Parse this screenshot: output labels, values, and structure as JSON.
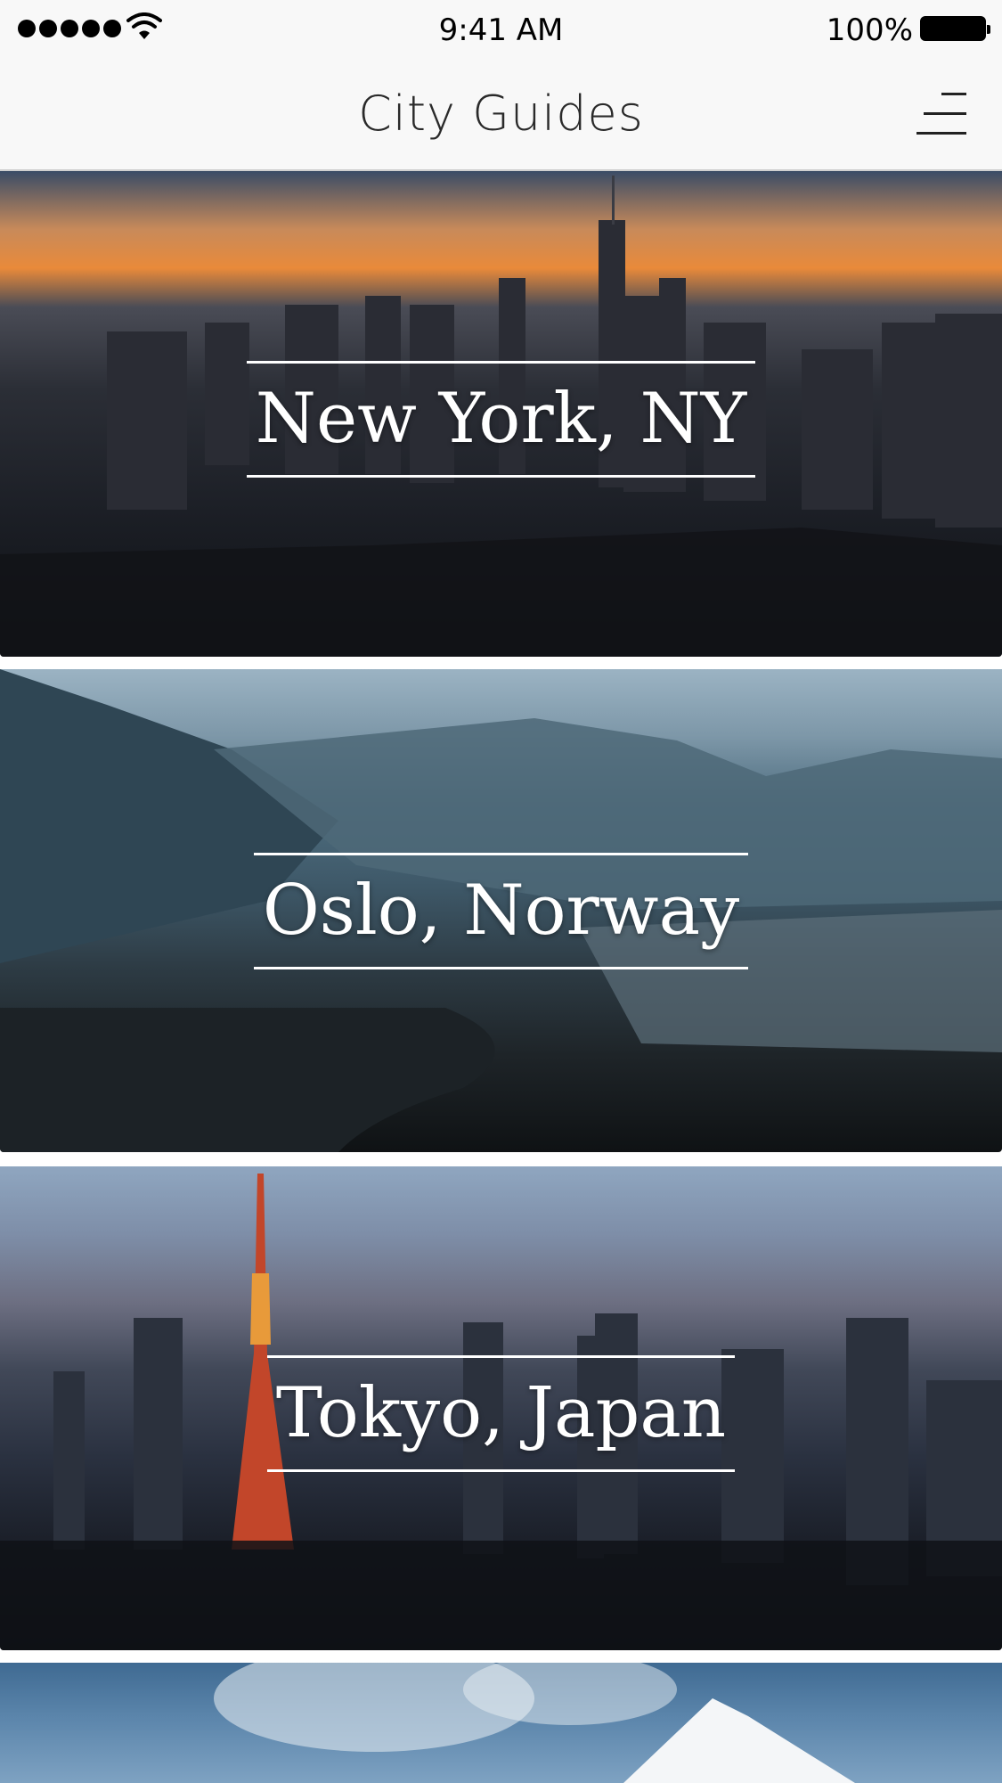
{
  "status_bar": {
    "time": "9:41 AM",
    "battery_percent": "100%",
    "signal_icon": "signal-dots-icon",
    "wifi_icon": "wifi-icon",
    "battery_icon": "battery-icon"
  },
  "nav": {
    "title": "City Guides",
    "menu_icon": "hamburger-menu-icon"
  },
  "cities": [
    {
      "label": "New York, NY"
    },
    {
      "label": "Oslo, Norway"
    },
    {
      "label": "Tokyo, Japan"
    }
  ]
}
